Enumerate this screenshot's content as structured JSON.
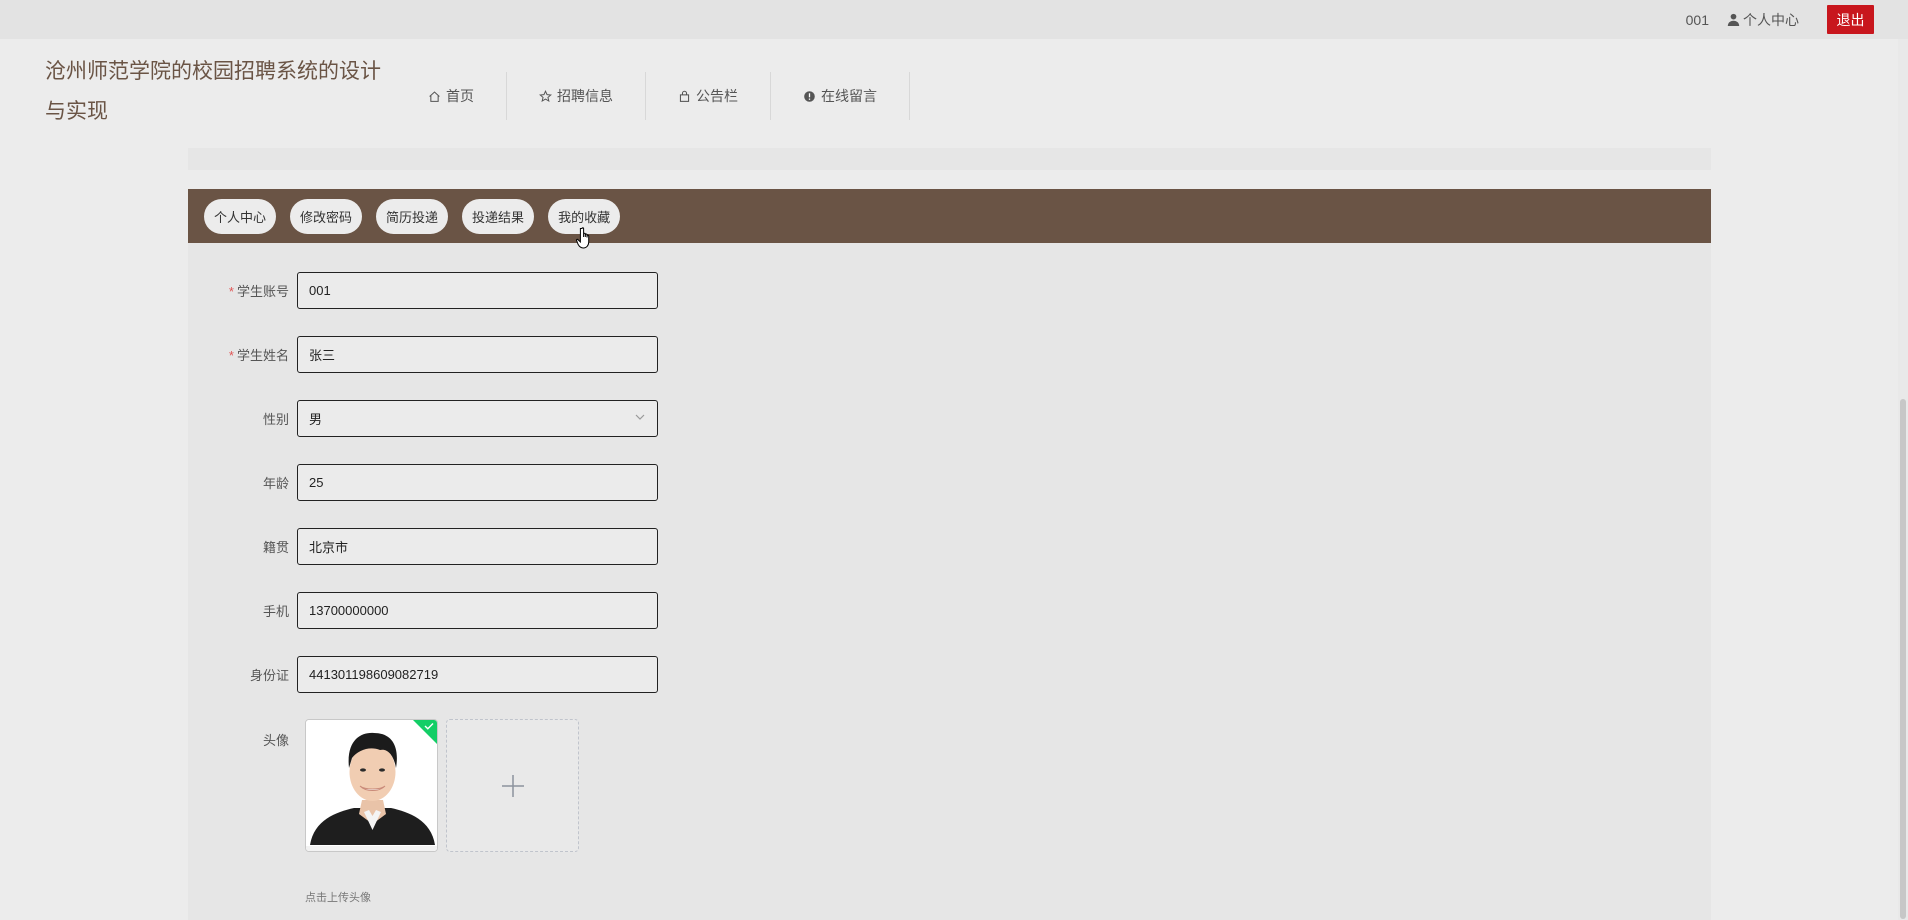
{
  "topbar": {
    "user_id": "001",
    "center_label": "个人中心",
    "logout_label": "退出"
  },
  "header": {
    "title": "沧州师范学院的校园招聘系统的设计与实现",
    "nav": [
      {
        "label": "首页",
        "icon": "home-icon"
      },
      {
        "label": "招聘信息",
        "icon": "star-icon"
      },
      {
        "label": "公告栏",
        "icon": "bag-icon"
      },
      {
        "label": "在线留言",
        "icon": "alert-circle-icon"
      }
    ]
  },
  "tabs": [
    {
      "label": "个人中心"
    },
    {
      "label": "修改密码"
    },
    {
      "label": "简历投递"
    },
    {
      "label": "投递结果"
    },
    {
      "label": "我的收藏"
    }
  ],
  "form": {
    "account": {
      "label": "学生账号",
      "value": "001",
      "required": true
    },
    "name": {
      "label": "学生姓名",
      "value": "张三",
      "required": true
    },
    "gender": {
      "label": "性别",
      "value": "男"
    },
    "age": {
      "label": "年龄",
      "value": "25"
    },
    "native": {
      "label": "籍贯",
      "value": "北京市"
    },
    "phone": {
      "label": "手机",
      "value": "13700000000"
    },
    "id_card": {
      "label": "身份证",
      "value": "441301198609082719"
    },
    "avatar": {
      "label": "头像",
      "tip": "点击上传头像"
    }
  },
  "colors": {
    "brand": "#6a5445",
    "logout": "#c8161d",
    "required": "#e05656",
    "success": "#13ce66"
  }
}
